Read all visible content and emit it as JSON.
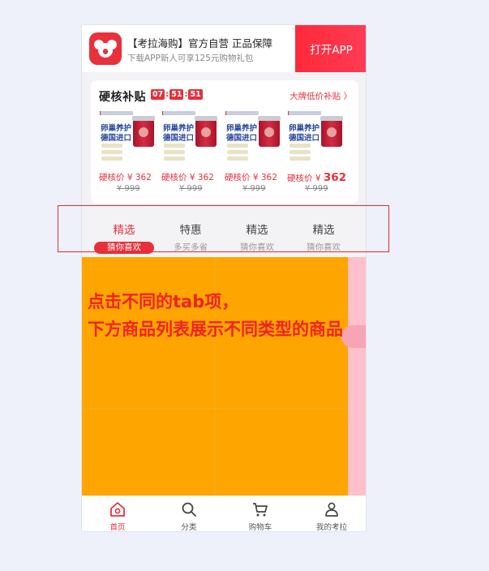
{
  "banner": {
    "title": "【考拉海购】官方自营 正品保障",
    "subtitle": "下载APP新人可享125元购物礼包",
    "open_app_label": "打开APP"
  },
  "subsidy": {
    "title": "硬核补贴",
    "timer": [
      "07",
      "51",
      "51"
    ],
    "brand_link": "大牌低价补贴 〉",
    "products": [
      {
        "label_line1": "卵巢养护",
        "label_line2": "德国进口",
        "price_label": "硬核价 ¥ 362",
        "original_price": "¥ 999"
      },
      {
        "label_line1": "卵巢养护",
        "label_line2": "德国进口",
        "price_label": "硬核价 ¥ 362",
        "original_price": "¥ 999"
      },
      {
        "label_line1": "卵巢养护",
        "label_line2": "德国进口",
        "price_label": "硬核价 ¥ 362",
        "original_price": "¥ 999"
      },
      {
        "label_line1": "卵巢养护",
        "label_line2": "德国进口",
        "price_prefix": "硬核价 ¥ ",
        "price_value": "362",
        "original_price": "¥ 999"
      }
    ]
  },
  "tabs": [
    {
      "label": "精选",
      "sub": "猜你喜欢",
      "active": true
    },
    {
      "label": "特惠",
      "sub": "多买多省",
      "active": false
    },
    {
      "label": "精选",
      "sub": "猜你喜欢",
      "active": false
    },
    {
      "label": "精选",
      "sub": "猜你喜欢",
      "active": false
    }
  ],
  "nav": [
    {
      "label": "首页",
      "icon": "home-icon",
      "active": true
    },
    {
      "label": "分类",
      "icon": "search-icon",
      "active": false
    },
    {
      "label": "购物车",
      "icon": "cart-icon",
      "active": false
    },
    {
      "label": "我的考拉",
      "icon": "user-icon",
      "active": false
    }
  ],
  "annotation": {
    "line1": "点击不同的tab项，",
    "line2": "下方商品列表展示不同类型的商品"
  },
  "colors": {
    "accent": "#e8303a",
    "list_area": "#ffa500",
    "list_side": "#ffc0cb",
    "page_bg": "#eef1f9"
  }
}
